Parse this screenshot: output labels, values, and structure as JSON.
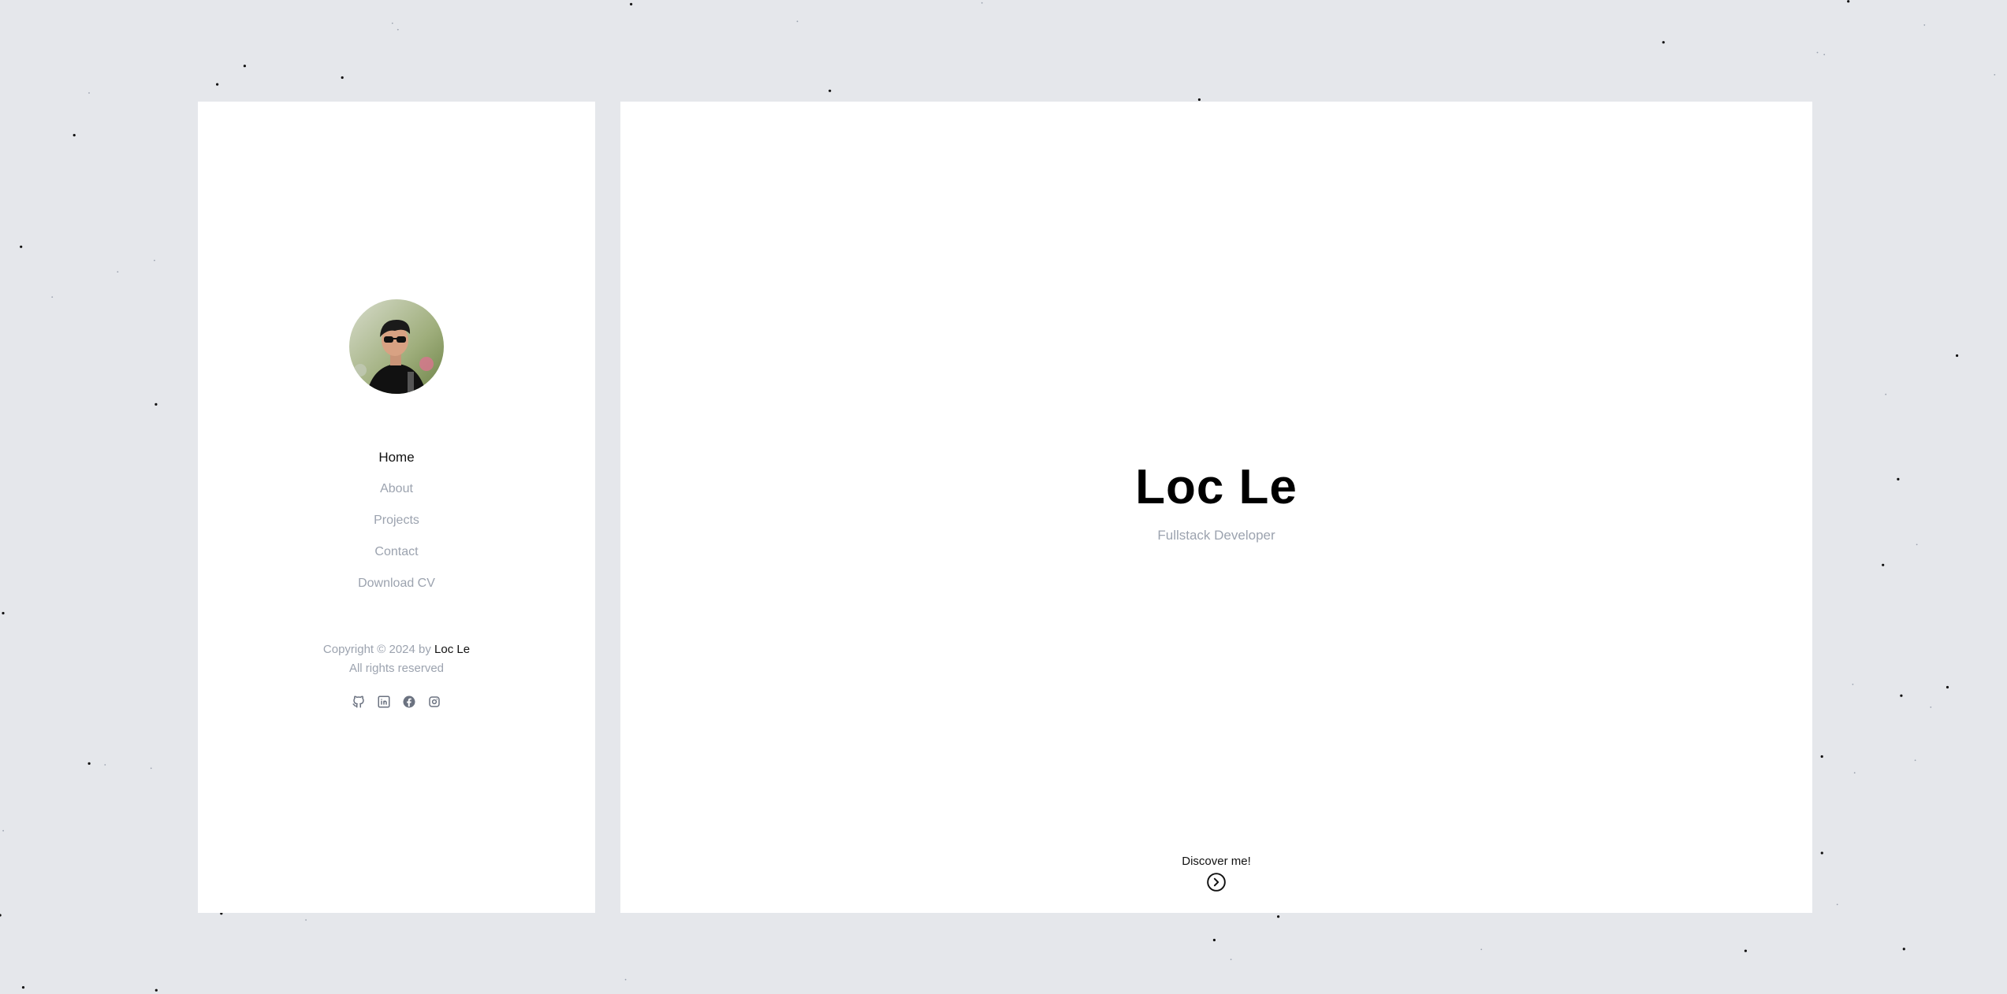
{
  "sidebar": {
    "avatar_alt": "Loc Le avatar",
    "nav": [
      {
        "label": "Home",
        "active": true
      },
      {
        "label": "About",
        "active": false
      },
      {
        "label": "Projects",
        "active": false
      },
      {
        "label": "Contact",
        "active": false
      },
      {
        "label": "Download CV",
        "active": false
      }
    ],
    "copyright_prefix": "Copyright © 2024 by ",
    "copyright_owner": "Loc Le",
    "rights": "All rights reserved",
    "socials": [
      "github-icon",
      "linkedin-icon",
      "facebook-icon",
      "instagram-icon"
    ]
  },
  "hero": {
    "name": "Loc Le",
    "role": "Fullstack Developer",
    "discover_label": "Discover me!"
  },
  "colors": {
    "background": "#e5e7eb",
    "panel": "#ffffff",
    "text": "#111111",
    "muted": "#9ca3af",
    "icon": "#6b7280"
  }
}
